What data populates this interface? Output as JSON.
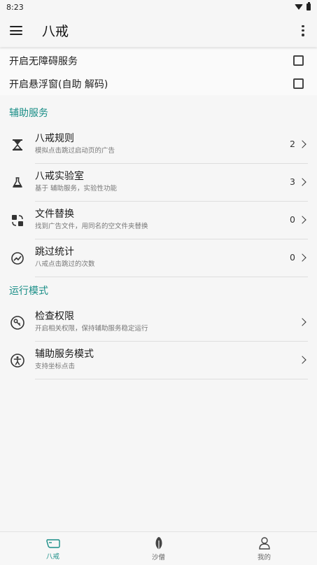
{
  "status_bar": {
    "time": "8:23"
  },
  "app_bar": {
    "title": "八戒"
  },
  "toggles": [
    {
      "label": "开启无障碍服务",
      "checked": false
    },
    {
      "label": "开启悬浮窗(自助 解码)",
      "checked": false
    }
  ],
  "sections": [
    {
      "header": "辅助服务",
      "items": [
        {
          "title": "八戒规则",
          "subtitle": "模拟点击跳过启动页的广告",
          "count": "2",
          "icon": "hourglass-icon"
        },
        {
          "title": "八戒实验室",
          "subtitle": "基于 辅助服务，实验性功能",
          "count": "3",
          "icon": "flask-icon"
        },
        {
          "title": "文件替换",
          "subtitle": "找到广告文件，用同名的空文件夹替换",
          "count": "0",
          "icon": "file-swap-icon"
        },
        {
          "title": "跳过统计",
          "subtitle": "八戒点击跳过的次数",
          "count": "0",
          "icon": "chart-icon"
        }
      ]
    },
    {
      "header": "运行模式",
      "items": [
        {
          "title": "检查权限",
          "subtitle": "开启相关权限，保持辅助服务稳定运行",
          "count": "",
          "icon": "permission-icon"
        },
        {
          "title": "辅助服务模式",
          "subtitle": "支持坐标点击",
          "count": "",
          "icon": "accessibility-icon"
        }
      ]
    }
  ],
  "bottom_nav": [
    {
      "label": "八戒",
      "icon": "pig-icon",
      "active": true
    },
    {
      "label": "沙僧",
      "icon": "leaf-icon",
      "active": false
    },
    {
      "label": "我的",
      "icon": "person-icon",
      "active": false
    }
  ],
  "colors": {
    "accent": "#1a8e87",
    "background": "#f6f6f6"
  }
}
